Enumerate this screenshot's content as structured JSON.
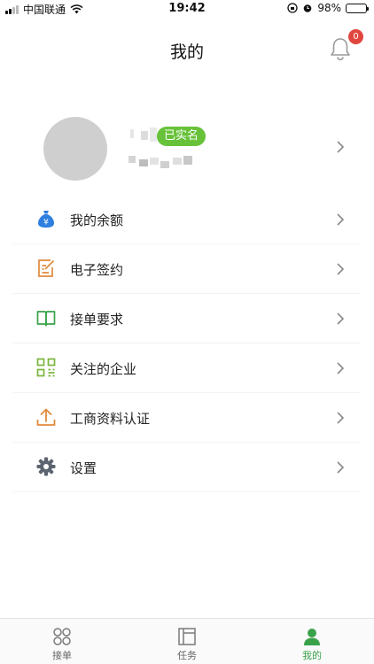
{
  "status_bar": {
    "carrier": "中国联通",
    "time": "19:42",
    "battery": "98%",
    "battery_level": 0.98
  },
  "nav": {
    "title": "我的",
    "notification_count": "0"
  },
  "profile": {
    "verified_badge": "已实名"
  },
  "menu": {
    "items": [
      {
        "label": "我的余额",
        "icon": "money-bag-icon",
        "color": "#2f7fe0"
      },
      {
        "label": "电子签约",
        "icon": "sign-icon",
        "color": "#e08a3c"
      },
      {
        "label": "接单要求",
        "icon": "book-icon",
        "color": "#3aa14a"
      },
      {
        "label": "关注的企业",
        "icon": "grid-icon",
        "color": "#7ab53a"
      },
      {
        "label": "工商资料认证",
        "icon": "upload-icon",
        "color": "#e08a3c"
      },
      {
        "label": "设置",
        "icon": "gear-icon",
        "color": "#5b6470"
      }
    ]
  },
  "tabbar": {
    "tabs": [
      {
        "label": "接单",
        "icon": "orders-icon",
        "active": false
      },
      {
        "label": "任务",
        "icon": "task-icon",
        "active": false
      },
      {
        "label": "我的",
        "icon": "profile-icon",
        "active": true
      }
    ]
  },
  "colors": {
    "accent_green": "#3aa14a",
    "badge_green": "#67c23a",
    "badge_red": "#e0463e"
  }
}
